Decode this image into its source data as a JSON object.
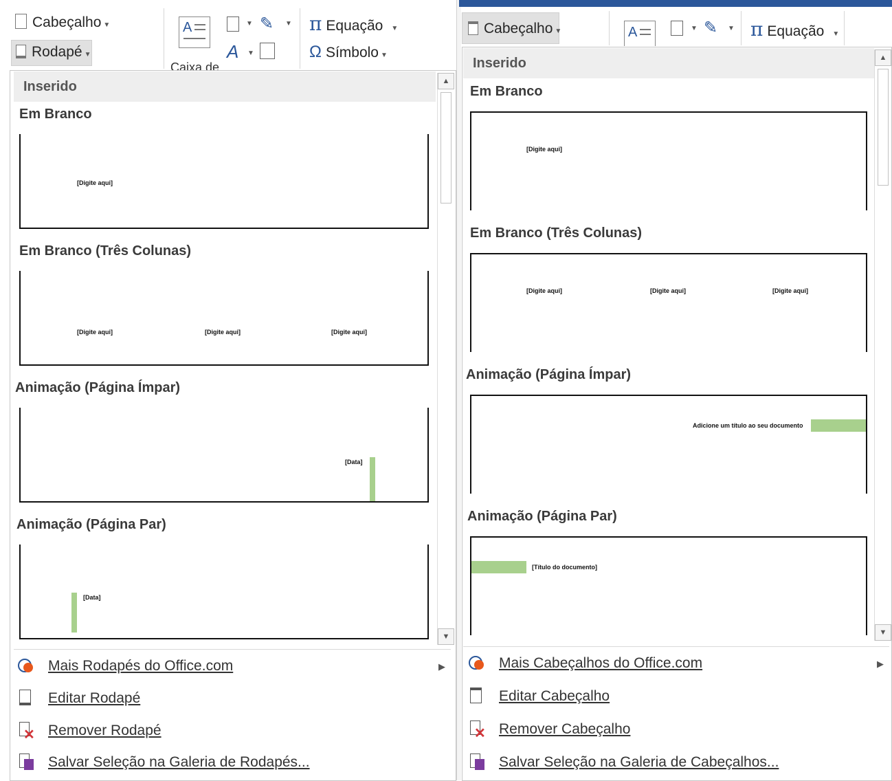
{
  "left": {
    "ribbon": {
      "cabecalho": "Cabeçalho",
      "rodape": "Rodapé",
      "equacao": "Equação",
      "simbolo": "Símbolo",
      "caixa": "Caixa de"
    },
    "category": "Inserido",
    "items": [
      {
        "title": "Em Branco",
        "placeholders": [
          "[Digite aqui]"
        ]
      },
      {
        "title": "Em Branco (Três Colunas)",
        "placeholders": [
          "[Digite aqui]",
          "[Digite aqui]",
          "[Digite aqui]"
        ]
      },
      {
        "title": "Animação (Página Ímpar)",
        "placeholders": [
          "[Data]"
        ]
      },
      {
        "title": "Animação (Página Par)",
        "placeholders": [
          "[Data]"
        ]
      }
    ],
    "menu": [
      {
        "label": "Mais Rodapés do Office.com",
        "icon": "office-globe-icon"
      },
      {
        "label": "Editar Rodapé",
        "icon": "edit-footer-icon"
      },
      {
        "label": "Remover Rodapé",
        "icon": "remove-footer-icon"
      },
      {
        "label": "Salvar Seleção na Galeria de Rodapés...",
        "icon": "save-gallery-icon"
      }
    ]
  },
  "right": {
    "ribbon": {
      "cabecalho": "Cabeçalho",
      "equacao": "Equação"
    },
    "category": "Inserido",
    "items": [
      {
        "title": "Em Branco",
        "placeholders": [
          "[Digite aqui]"
        ]
      },
      {
        "title": "Em Branco (Três Colunas)",
        "placeholders": [
          "[Digite aqui]",
          "[Digite aqui]",
          "[Digite aqui]"
        ]
      },
      {
        "title": "Animação (Página Ímpar)",
        "placeholders": [
          "Adicione um título ao seu documento"
        ]
      },
      {
        "title": "Animação (Página Par)",
        "placeholders": [
          "[Título do documento]"
        ]
      }
    ],
    "menu": [
      {
        "label": "Mais Cabeçalhos do Office.com",
        "icon": "office-globe-icon"
      },
      {
        "label": "Editar Cabeçalho",
        "icon": "edit-header-icon"
      },
      {
        "label": "Remover Cabeçalho",
        "icon": "remove-header-icon"
      },
      {
        "label": "Salvar Seleção na Galeria de Cabeçalhos...",
        "icon": "save-gallery-icon"
      }
    ]
  },
  "colors": {
    "accent_bar": "#2b579a",
    "green_bar": "#a8d08d",
    "pi_blue": "#2b579a"
  }
}
